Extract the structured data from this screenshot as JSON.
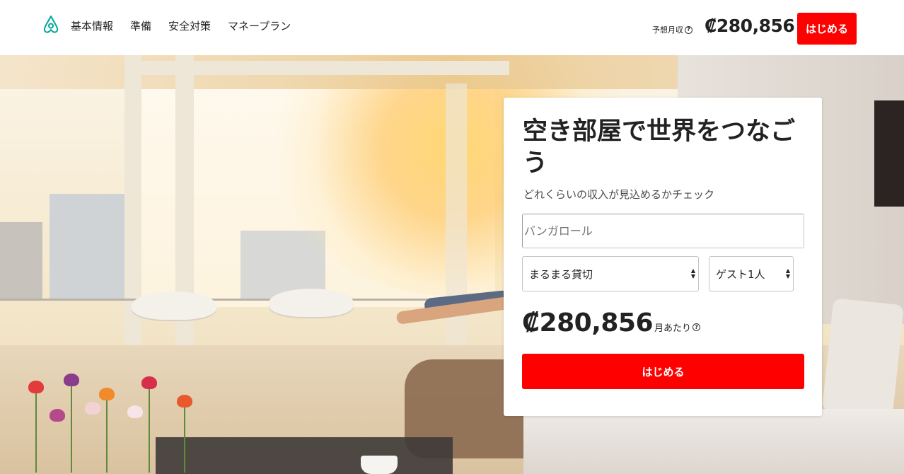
{
  "header": {
    "logo_icon": "airbnb-logo-icon",
    "nav": [
      "基本情報",
      "準備",
      "安全対策",
      "マネープラン"
    ],
    "earn_label": "予想月収",
    "earn_amount": "₡280,856",
    "start_button": "はじめる"
  },
  "hero": {
    "image_subject": "sunlit living room"
  },
  "card": {
    "title": "空き部屋で世界をつなごう",
    "subtitle": "どれくらいの収入が見込めるかチェック",
    "city_placeholder": "バンガロール",
    "room_type": "まるまる貸切",
    "guests": "ゲスト1人",
    "price": "₡280,856",
    "per_month": "月あたり",
    "start_button": "はじめる"
  },
  "colors": {
    "accent": "#ff0000",
    "logo": "#00a699"
  }
}
